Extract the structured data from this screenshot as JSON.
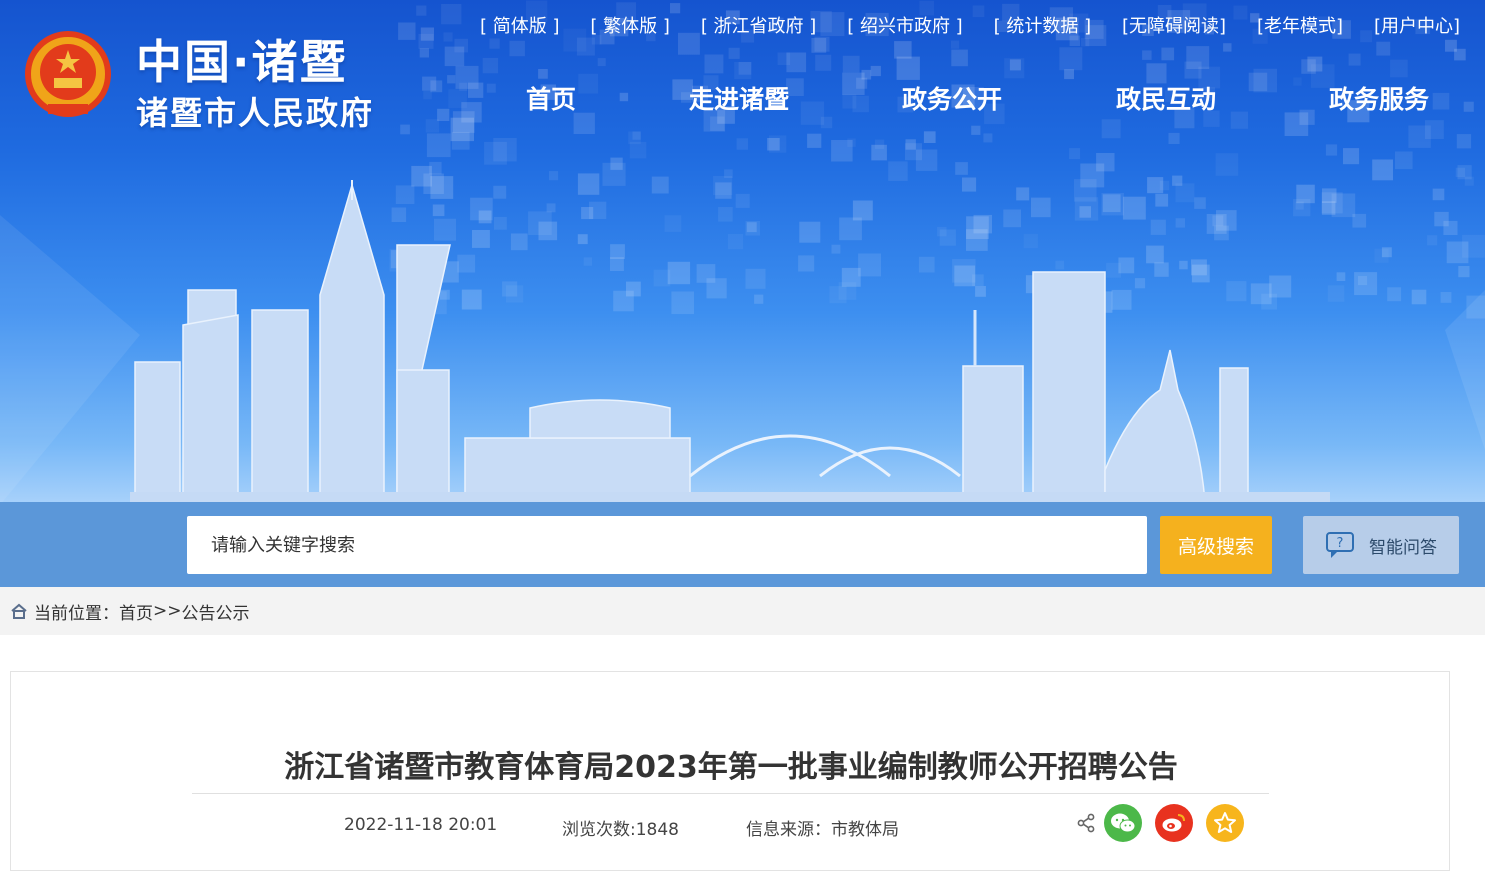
{
  "site": {
    "title_line1": "中国·诸暨",
    "title_line2": "诸暨市人民政府"
  },
  "top_links": [
    "[ 简体版 ]",
    "[ 繁体版 ]",
    "[ 浙江省政府 ]",
    "[ 绍兴市政府 ]",
    "[ 统计数据 ]",
    "[无障碍阅读]",
    "[老年模式]",
    "[用户中心]"
  ],
  "nav": [
    "首页",
    "走进诸暨",
    "政务公开",
    "政民互动",
    "政务服务"
  ],
  "search": {
    "placeholder": "请输入关键字搜索",
    "advanced_label": "高级搜索",
    "ai_label": "智能问答"
  },
  "breadcrumb": {
    "prefix": "当前位置：",
    "home": "首页",
    "separator": ">>",
    "current": "公告公示"
  },
  "article": {
    "title": "浙江省诸暨市教育体育局2023年第一批事业编制教师公开招聘公告",
    "date": "2022-11-18 20:01",
    "views": "浏览次数:1848",
    "source": "信息来源：市教体局"
  },
  "icons": [
    "national-emblem-icon",
    "home-icon",
    "chat-bubble-question-icon",
    "share-icon",
    "wechat-icon",
    "weibo-icon",
    "star-icon"
  ],
  "colors": {
    "banner_top": "#1554cf",
    "search_bar": "#5b97d9",
    "advanced_search": "#f5b11e",
    "ai_button": "#b7cde9",
    "wechat": "#4cb849",
    "weibo": "#e8321f",
    "favorite": "#f7b51c"
  }
}
